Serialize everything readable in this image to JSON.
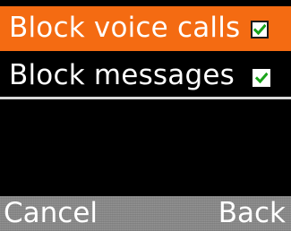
{
  "menu": {
    "items": [
      {
        "label": "Block voice calls",
        "checked": true,
        "selected": true
      },
      {
        "label": "Block messages",
        "checked": true,
        "selected": false
      }
    ]
  },
  "softkeys": {
    "left_label": "Cancel",
    "right_label": "Back"
  },
  "colors": {
    "highlight": "#f46b12",
    "background": "#000000",
    "softkey_bar": "#8c8c8c",
    "checkmark": "#1aa31a"
  },
  "icons": {
    "checkbox": "checkbox-checked-icon"
  }
}
